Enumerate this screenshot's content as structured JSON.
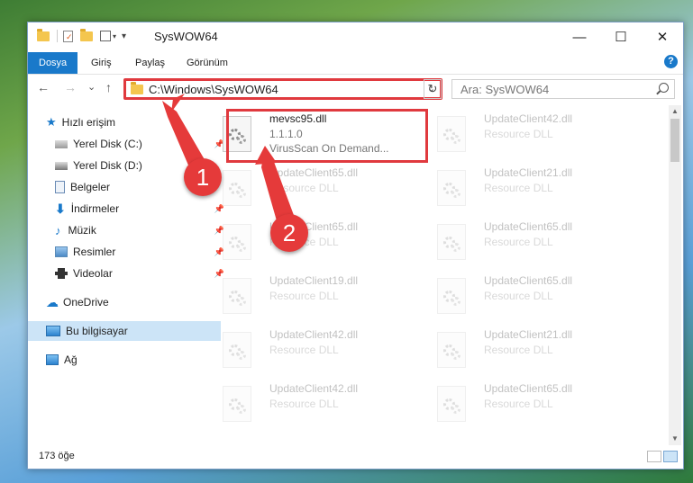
{
  "window": {
    "title": "SysWOW64",
    "minimize": "—",
    "maximize": "☐",
    "close": "✕"
  },
  "ribbon": {
    "tabs": [
      "Dosya",
      "Giriş",
      "Paylaş",
      "Görünüm"
    ],
    "help": "?"
  },
  "navigation": {
    "back": "←",
    "forward": "→",
    "recent": "⌄",
    "up": "↑",
    "address": "C:\\Windows\\SysWOW64",
    "refresh": "↻",
    "search_placeholder": "Ara: SysWOW64"
  },
  "sidebar": {
    "items": [
      {
        "label": "Hızlı erişim",
        "icon": "star-icon"
      },
      {
        "label": "Yerel Disk (C:)",
        "icon": "drive-icon"
      },
      {
        "label": "Yerel Disk (D:)",
        "icon": "drive-icon"
      },
      {
        "label": "Belgeler",
        "icon": "documents-icon"
      },
      {
        "label": "İndirmeler",
        "icon": "download-icon"
      },
      {
        "label": "Müzik",
        "icon": "music-icon"
      },
      {
        "label": "Resimler",
        "icon": "pictures-icon"
      },
      {
        "label": "Videolar",
        "icon": "video-icon"
      },
      {
        "label": "OneDrive",
        "icon": "cloud-icon"
      },
      {
        "label": "Bu bilgisayar",
        "icon": "computer-icon"
      },
      {
        "label": "Ağ",
        "icon": "network-icon"
      }
    ],
    "selected": "Bu bilgisayar"
  },
  "files": [
    {
      "name": "mevsc95.dll",
      "line1": "1.1.1.0",
      "line2": "VirusScan On Demand..."
    },
    {
      "name": "UpdateClient42.dll",
      "line1": "Resource DLL"
    },
    {
      "name": "UpdateClient65.dll",
      "line1": "Resource DLL"
    },
    {
      "name": "UpdateClient21.dll",
      "line1": "Resource DLL"
    },
    {
      "name": "UpdateClient65.dll",
      "line1": "Resource DLL"
    },
    {
      "name": "UpdateClient65.dll",
      "line1": "Resource DLL"
    },
    {
      "name": "UpdateClient19.dll",
      "line1": "Resource DLL"
    },
    {
      "name": "UpdateClient65.dll",
      "line1": "Resource DLL"
    },
    {
      "name": "UpdateClient42.dll",
      "line1": "Resource DLL"
    },
    {
      "name": "UpdateClient21.dll",
      "line1": "Resource DLL"
    },
    {
      "name": "UpdateClient42.dll",
      "line1": "Resource DLL"
    },
    {
      "name": "UpdateClient65.dll",
      "line1": "Resource DLL"
    }
  ],
  "status": {
    "count": "173 öğe"
  },
  "callouts": [
    "1",
    "2"
  ],
  "colors": {
    "accent": "#1979ca",
    "highlight_red": "#e0393e",
    "selected_bg": "#cce4f7"
  }
}
